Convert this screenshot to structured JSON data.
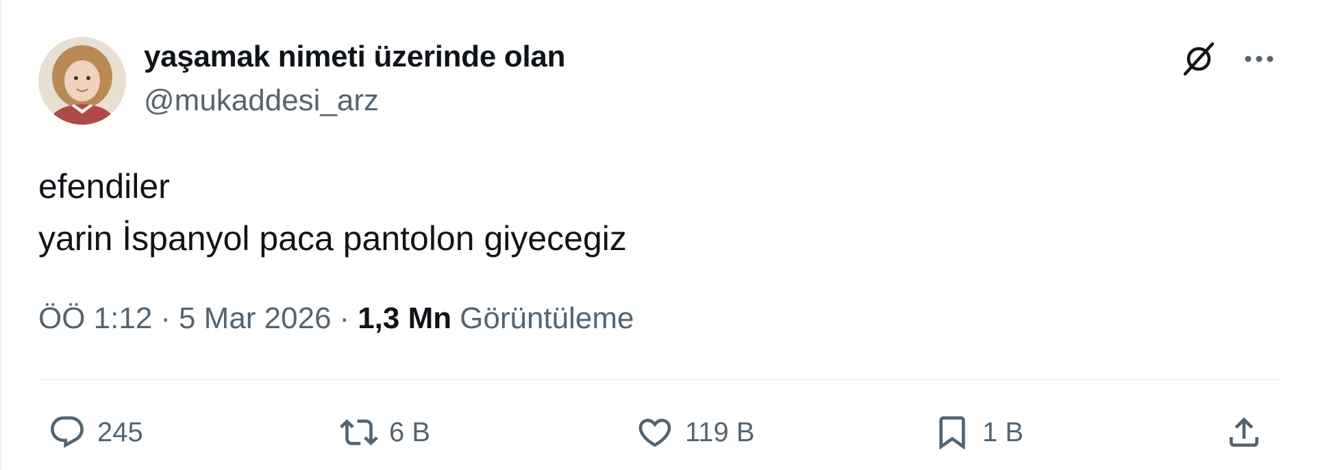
{
  "author": {
    "display_name": "yaşamak nimeti üzerinde olan",
    "handle": "@mukaddesi_arz"
  },
  "tweet": {
    "lines": [
      "efendiler",
      "yarin İspanyol paca pantolon giyecegiz"
    ]
  },
  "meta": {
    "time": "ÖÖ 1:12",
    "separator": "·",
    "date": "5 Mar 2026",
    "views_count": "1,3 Mn",
    "views_label": "Görüntüleme"
  },
  "actions": {
    "replies": "245",
    "reposts": "6 B",
    "likes": "119 B",
    "bookmarks": "1 B"
  },
  "icons": {
    "header_right": [
      "grok-icon",
      "more-icon"
    ],
    "actions": [
      "reply-icon",
      "repost-icon",
      "like-icon",
      "bookmark-icon",
      "share-icon"
    ]
  },
  "colors": {
    "primary_text": "#0f1419",
    "secondary_text": "#536471",
    "divider": "#eff3f4",
    "background": "#ffffff"
  }
}
